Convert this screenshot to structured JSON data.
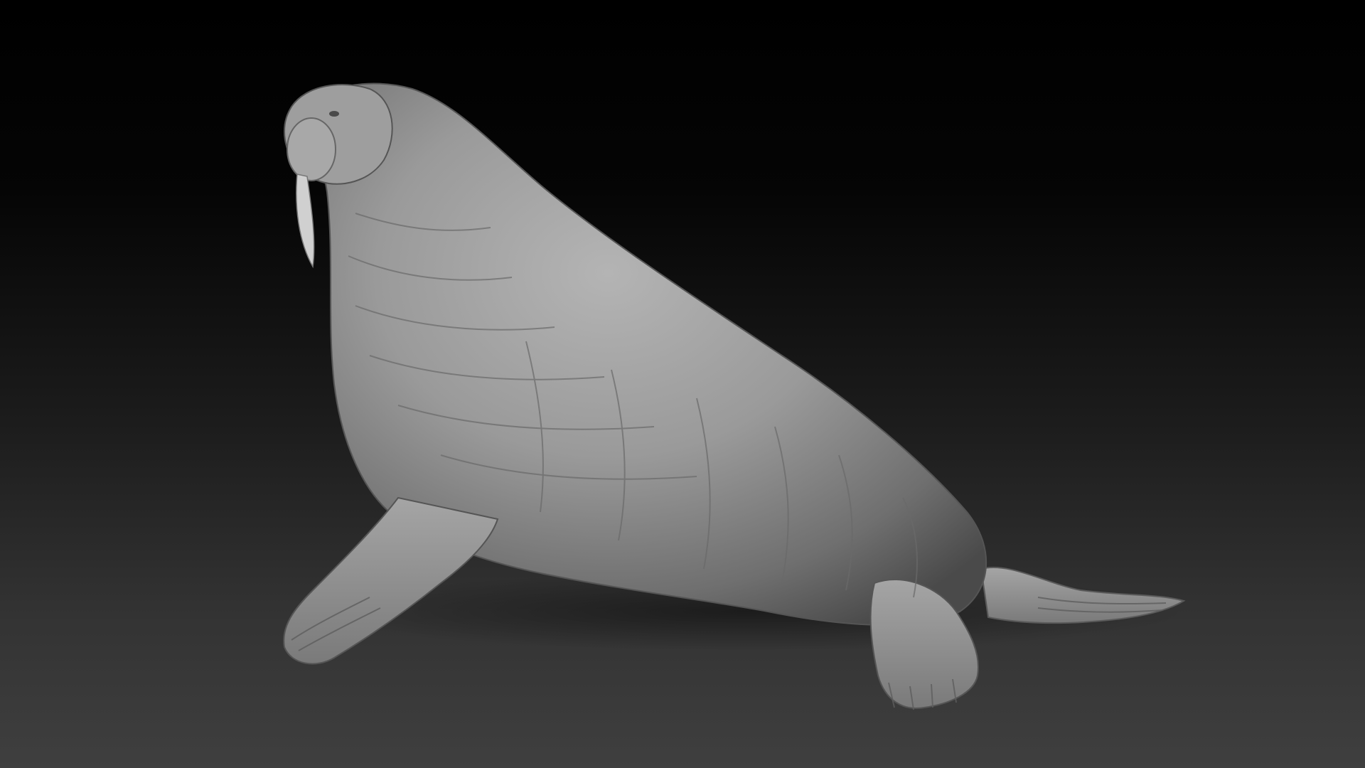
{
  "scene": {
    "subject": "walrus-sculpt",
    "background_top_color": "#000000",
    "background_bottom_color": "#3f3f3f",
    "material_color": "#8f8f8f"
  }
}
